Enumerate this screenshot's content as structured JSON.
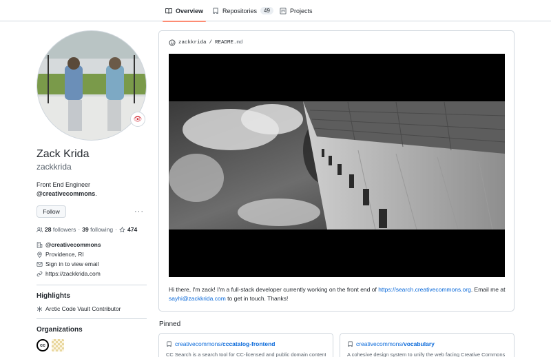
{
  "tabs": [
    {
      "label": "Overview",
      "icon": "book-icon",
      "selected": true
    },
    {
      "label": "Repositories",
      "icon": "repo-icon",
      "count": "49"
    },
    {
      "label": "Projects",
      "icon": "project-icon"
    }
  ],
  "profile": {
    "status_icon": "eye-emoji-icon",
    "fullname": "Zack Krida",
    "login": "zackkrida",
    "bio_line1": "Front End Engineer",
    "bio_org": "@creativecommons",
    "bio_suffix": ".",
    "follow_label": "Follow",
    "followers_count": "28",
    "followers_label": "followers",
    "following_count": "39",
    "following_label": "following",
    "separator": "·",
    "stars_count": "474",
    "company": "@creativecommons",
    "location": "Providence, RI",
    "email": "Sign in to view email",
    "website": "https://zackkrida.com"
  },
  "highlights": {
    "title": "Highlights",
    "item": "Arctic Code Vault Contributor"
  },
  "organizations": {
    "title": "Organizations",
    "cc_label": "cc"
  },
  "readme": {
    "owner": "zackkrida",
    "slash": "/",
    "file": "README",
    "ext": ".md",
    "text_1": "Hi there, I'm zack! I'm a full-stack developer currently working on the front end of ",
    "link_1": "https://search.creativecommons.org",
    "text_2": ". Email me at ",
    "link_2": "sayhi@zackkrida.com",
    "text_3": " to get in touch. Thanks!"
  },
  "pinned": {
    "title": "Pinned",
    "cards": [
      {
        "owner": "creativecommons",
        "slash": "/",
        "repo": "cccatalog-frontend",
        "desc": "CC Search is a search tool for CC-licensed and public domain content"
      },
      {
        "owner": "creativecommons",
        "slash": "/",
        "repo": "vocabulary",
        "desc": "A cohesive design system to unify the web facing Creative Commons"
      }
    ]
  },
  "colors": {
    "accent": "#0969da",
    "tab_underline": "#fd8c73",
    "border": "#d0d7de"
  }
}
